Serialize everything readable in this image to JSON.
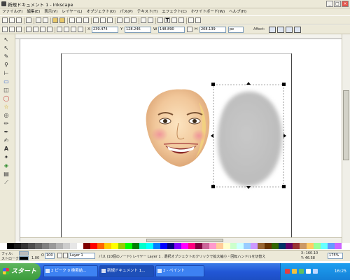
{
  "window": {
    "title": "新規ドキュメント 1 - Inkscape",
    "minimize": "_",
    "maximize": "□",
    "close": "×"
  },
  "menu": [
    "ファイル(F)",
    "編集(E)",
    "表示(V)",
    "レイヤー(L)",
    "オブジェクト(O)",
    "パス(P)",
    "テキスト(T)",
    "エフェクト(C)",
    "ホワイトボード(W)",
    "ヘルプ(H)"
  ],
  "controls": {
    "x_label": "X",
    "x_value": "239.474",
    "y_label": "Y",
    "y_value": "128.246",
    "w_label": "W",
    "w_value": "148.890",
    "h_label": "H",
    "h_value": "208.139",
    "unit": "px",
    "affect_label": "Affect:"
  },
  "tools": [
    "select-arrow-icon",
    "node-arrow-icon",
    "tweak-icon",
    "zoom-icon",
    "measure-icon",
    "rect-icon",
    "3dbox-icon",
    "ellipse-icon",
    "star-icon",
    "spiral-icon",
    "pencil-icon",
    "pen-icon",
    "calligraphy-icon",
    "text-icon",
    "spray-icon",
    "bucket-icon",
    "gradient-icon",
    "dropper-icon"
  ],
  "tool_glyphs": [
    "↖",
    "↖",
    "✎",
    "⚲",
    "⊢",
    "▭",
    "◫",
    "◯",
    "☆",
    "◎",
    "✏",
    "✒",
    "✍",
    "A",
    "✦",
    "◈",
    "▤",
    "⟋"
  ],
  "palette": [
    "#000000",
    "#1a1a1a",
    "#333333",
    "#4d4d4d",
    "#666666",
    "#808080",
    "#999999",
    "#b3b3b3",
    "#cccccc",
    "#e6e6e6",
    "#ffffff",
    "#800000",
    "#ff0000",
    "#ff6600",
    "#ffcc00",
    "#ffff00",
    "#99cc00",
    "#00ff00",
    "#008000",
    "#00ffcc",
    "#00ffff",
    "#0080ff",
    "#0000ff",
    "#000080",
    "#8000ff",
    "#ff00ff",
    "#ff0080",
    "#800040",
    "#cc6699",
    "#ff99cc",
    "#ffcc99",
    "#ffffcc",
    "#ccffcc",
    "#ccffff",
    "#99ccff",
    "#cc99ff",
    "#996633",
    "#663300",
    "#336600",
    "#003366",
    "#660066",
    "#993333",
    "#cc9966",
    "#ffcc66",
    "#99ff99",
    "#66ffff",
    "#6699ff",
    "#cc66ff"
  ],
  "status": {
    "fill_label": "フィル:",
    "stroke_label": "ストローク:",
    "stroke_value": "1.00",
    "opacity_label": "O",
    "opacity_value": "100",
    "layer": "Layer 1",
    "message": "パス (10個のノード) レイヤー Layer 1 . 選択オブジェクトのクリックで拡大縮小・回転ハンドルを切替え",
    "cursor_x": "X: 160.10",
    "cursor_y": "Y: 46.58",
    "zoom": "175%"
  },
  "taskbar": {
    "start_label": "スタート",
    "tasks": [
      "2 ピーク 0 検索結...",
      "新規ドキュメント 1...",
      "2 - ペイント"
    ],
    "clock": "16:25"
  }
}
